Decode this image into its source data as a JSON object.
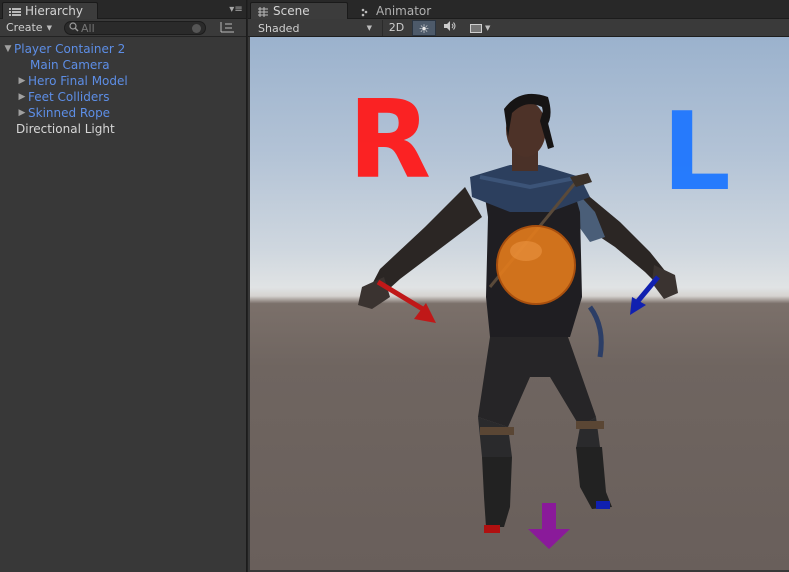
{
  "hierarchy": {
    "tab_label": "Hierarchy",
    "create_label": "Create",
    "search_placeholder": "All",
    "items": [
      {
        "label": "Player Container 2",
        "color": "#5d8ee6"
      },
      {
        "label": "Main Camera",
        "color": "#5d8ee6"
      },
      {
        "label": "Hero Final Model",
        "color": "#5d8ee6"
      },
      {
        "label": "Feet Colliders",
        "color": "#5d8ee6"
      },
      {
        "label": "Skinned Rope",
        "color": "#5d8ee6"
      },
      {
        "label": "Directional Light",
        "color": "#d7d7d7"
      }
    ]
  },
  "scene": {
    "tabs": [
      {
        "label": "Scene",
        "active": true
      },
      {
        "label": "Animator",
        "active": false
      }
    ],
    "shading_mode": "Shaded",
    "mode_2d_label": "2D",
    "overlay_letters": {
      "right": {
        "text": "R",
        "color": "#ff1a1a"
      },
      "left": {
        "text": "L",
        "color": "#1f77ff"
      }
    },
    "gizmo_colors": {
      "right_hand_arrow": "#c01818",
      "left_hand_arrow": "#1020b0",
      "foot_arrow": "#8a1a9a",
      "center_sphere": "#e07a1c"
    }
  }
}
